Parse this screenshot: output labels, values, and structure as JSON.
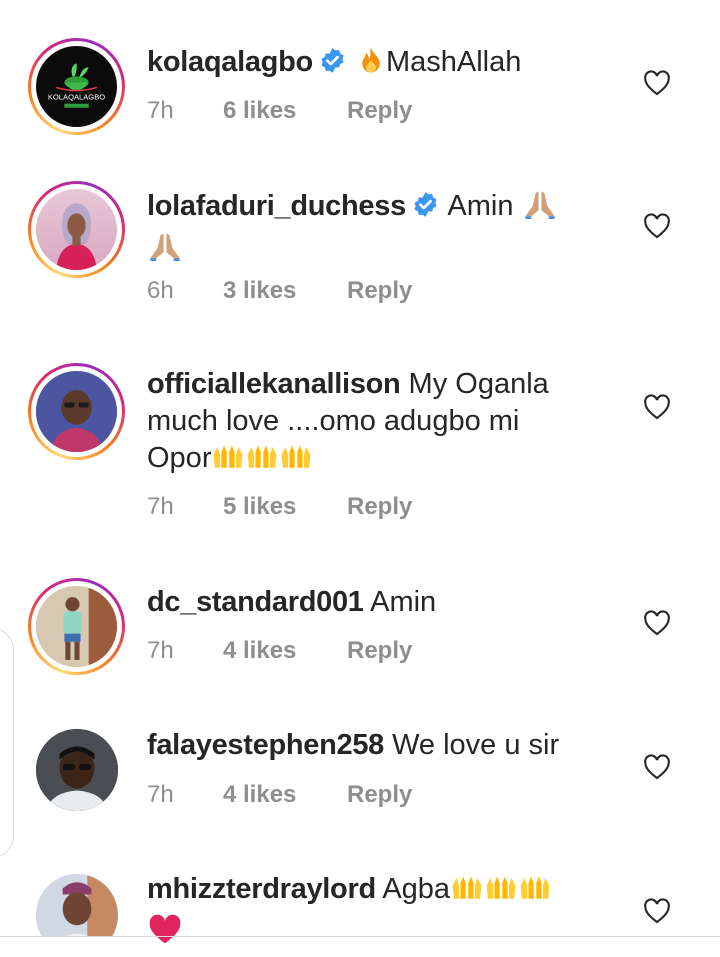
{
  "comments": [
    {
      "username": "kolaqalagbo",
      "verified": true,
      "text": "MashAllah",
      "emoji_prefix": "fire-emoji",
      "time": "7h",
      "likes": "6 likes",
      "reply": "Reply"
    },
    {
      "username": "lolafaduri_duchess",
      "verified": true,
      "text": "Amin",
      "emoji_suffix": [
        "folded-hands-emoji",
        "folded-hands-emoji"
      ],
      "time": "6h",
      "likes": "3 likes",
      "reply": "Reply"
    },
    {
      "username": "officiallekanallison",
      "verified": false,
      "text_line1": "My Oganla",
      "text_line2": "much love ....omo adugbo mi",
      "text_line3": "Opor",
      "emoji_suffix": [
        "raised-hands-emoji",
        "raised-hands-emoji",
        "raised-hands-emoji"
      ],
      "time": "7h",
      "likes": "5 likes",
      "reply": "Reply"
    },
    {
      "username": "dc_standard001",
      "verified": false,
      "text": "Amin",
      "time": "7h",
      "likes": "4 likes",
      "reply": "Reply"
    },
    {
      "username": "falayestephen258",
      "verified": false,
      "text": "We love u sir",
      "time": "7h",
      "likes": "4 likes",
      "reply": "Reply"
    },
    {
      "username": "mhizzterdraylord",
      "verified": false,
      "text": "Agba",
      "emoji_suffix": [
        "raised-hands-emoji",
        "raised-hands-emoji",
        "raised-hands-emoji",
        "red-heart-emoji"
      ]
    }
  ],
  "logo_text": "KOLAQALAGBO",
  "colors": {
    "text": "#262626",
    "meta": "#8e8e8e",
    "verified": "#3897f0",
    "heart_outline": "#262626",
    "red_heart": "#e0245e"
  },
  "icons": {
    "like": "heart-outline-icon",
    "verified": "verified-badge-icon"
  }
}
